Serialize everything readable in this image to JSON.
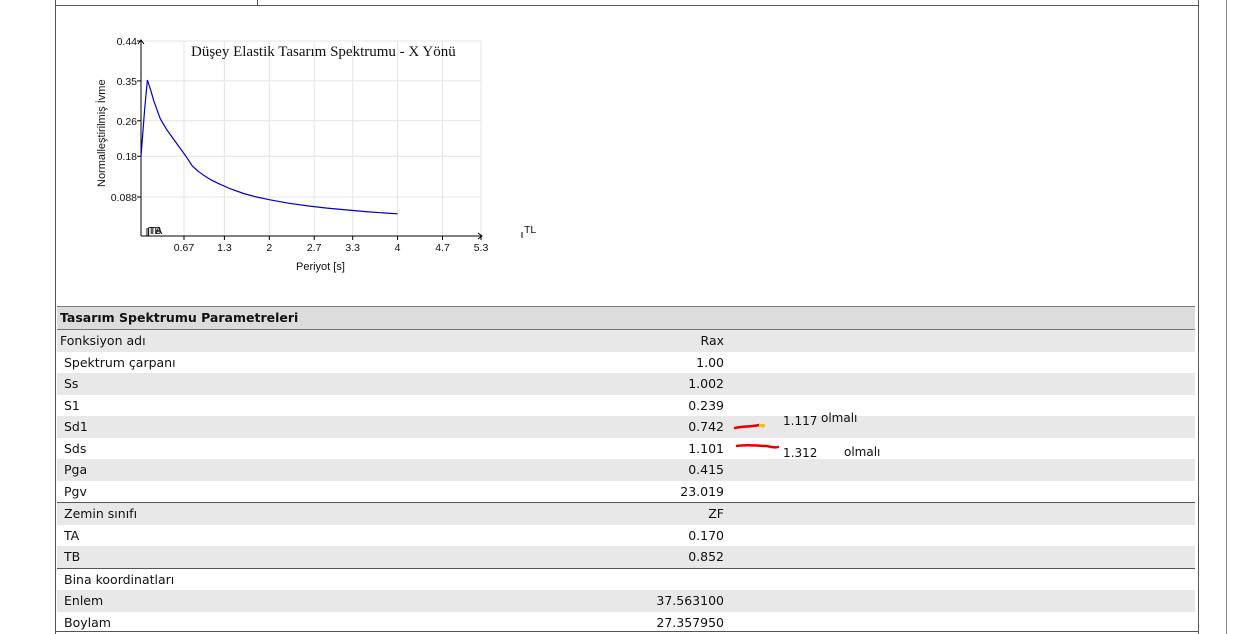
{
  "chart": {
    "tick_top_stub": "0.00"
  },
  "chart_data": {
    "type": "line",
    "title": "Düşey Elastik Tasarım Spektrumu - X Yönü",
    "xlabel": "Periyot [s]",
    "ylabel": "Normalleştirilmiş İvme",
    "xlim": [
      0,
      5.3
    ],
    "ylim": [
      0,
      0.44
    ],
    "x_ticks": [
      "0.67",
      "1.3",
      "2",
      "2.7",
      "3.3",
      "4",
      "4.7",
      "5.3"
    ],
    "y_ticks": [
      "0.088",
      "0.18",
      "0.26",
      "0.35",
      "0.44"
    ],
    "period_markers": [
      "TB",
      "TA",
      "TL"
    ],
    "grid": true,
    "series": [
      {
        "x": [
          0.0,
          0.06,
          0.1,
          0.15,
          0.2,
          0.25,
          0.3,
          0.4,
          0.5,
          0.6,
          0.7,
          0.8,
          0.9,
          1.0,
          1.1,
          1.2,
          1.4,
          1.6,
          1.8,
          2.0,
          2.3,
          2.6,
          2.9,
          3.2,
          3.5,
          3.8,
          4.0
        ],
        "y": [
          0.18,
          0.29,
          0.352,
          0.33,
          0.305,
          0.285,
          0.265,
          0.24,
          0.22,
          0.2,
          0.18,
          0.158,
          0.145,
          0.135,
          0.126,
          0.119,
          0.106,
          0.096,
          0.088,
          0.082,
          0.074,
          0.068,
          0.063,
          0.059,
          0.055,
          0.052,
          0.05
        ],
        "color": "#0000cc"
      }
    ]
  },
  "params": {
    "header": "Tasarım Spektrumu Parametreleri",
    "rows": [
      {
        "label": "Fonksiyon adı",
        "value": "Rax"
      },
      {
        "label": "Spektrum çarpanı",
        "value": "1.00"
      },
      {
        "label": "Ss",
        "value": "1.002"
      },
      {
        "label": "S1",
        "value": "0.239"
      },
      {
        "label": "Sd1",
        "value": "0.742"
      },
      {
        "label": "Sds",
        "value": "1.101"
      },
      {
        "label": "Pga",
        "value": "0.415"
      },
      {
        "label": "Pgv",
        "value": "23.019"
      },
      {
        "label": "Zemin sınıfı",
        "value": "ZF"
      },
      {
        "label": "TA",
        "value": "0.170"
      },
      {
        "label": "TB",
        "value": "0.852"
      },
      {
        "label": "Bina koordinatları",
        "value": ""
      },
      {
        "label": "Enlem",
        "value": "37.563100"
      },
      {
        "label": "Boylam",
        "value": "27.357950"
      }
    ]
  },
  "annotations": {
    "sd1_value": "1.117",
    "sd1_note": "olmalı",
    "sds_value": "1.312",
    "sds_note": "olmalı",
    "mark_color": "#e60000"
  }
}
